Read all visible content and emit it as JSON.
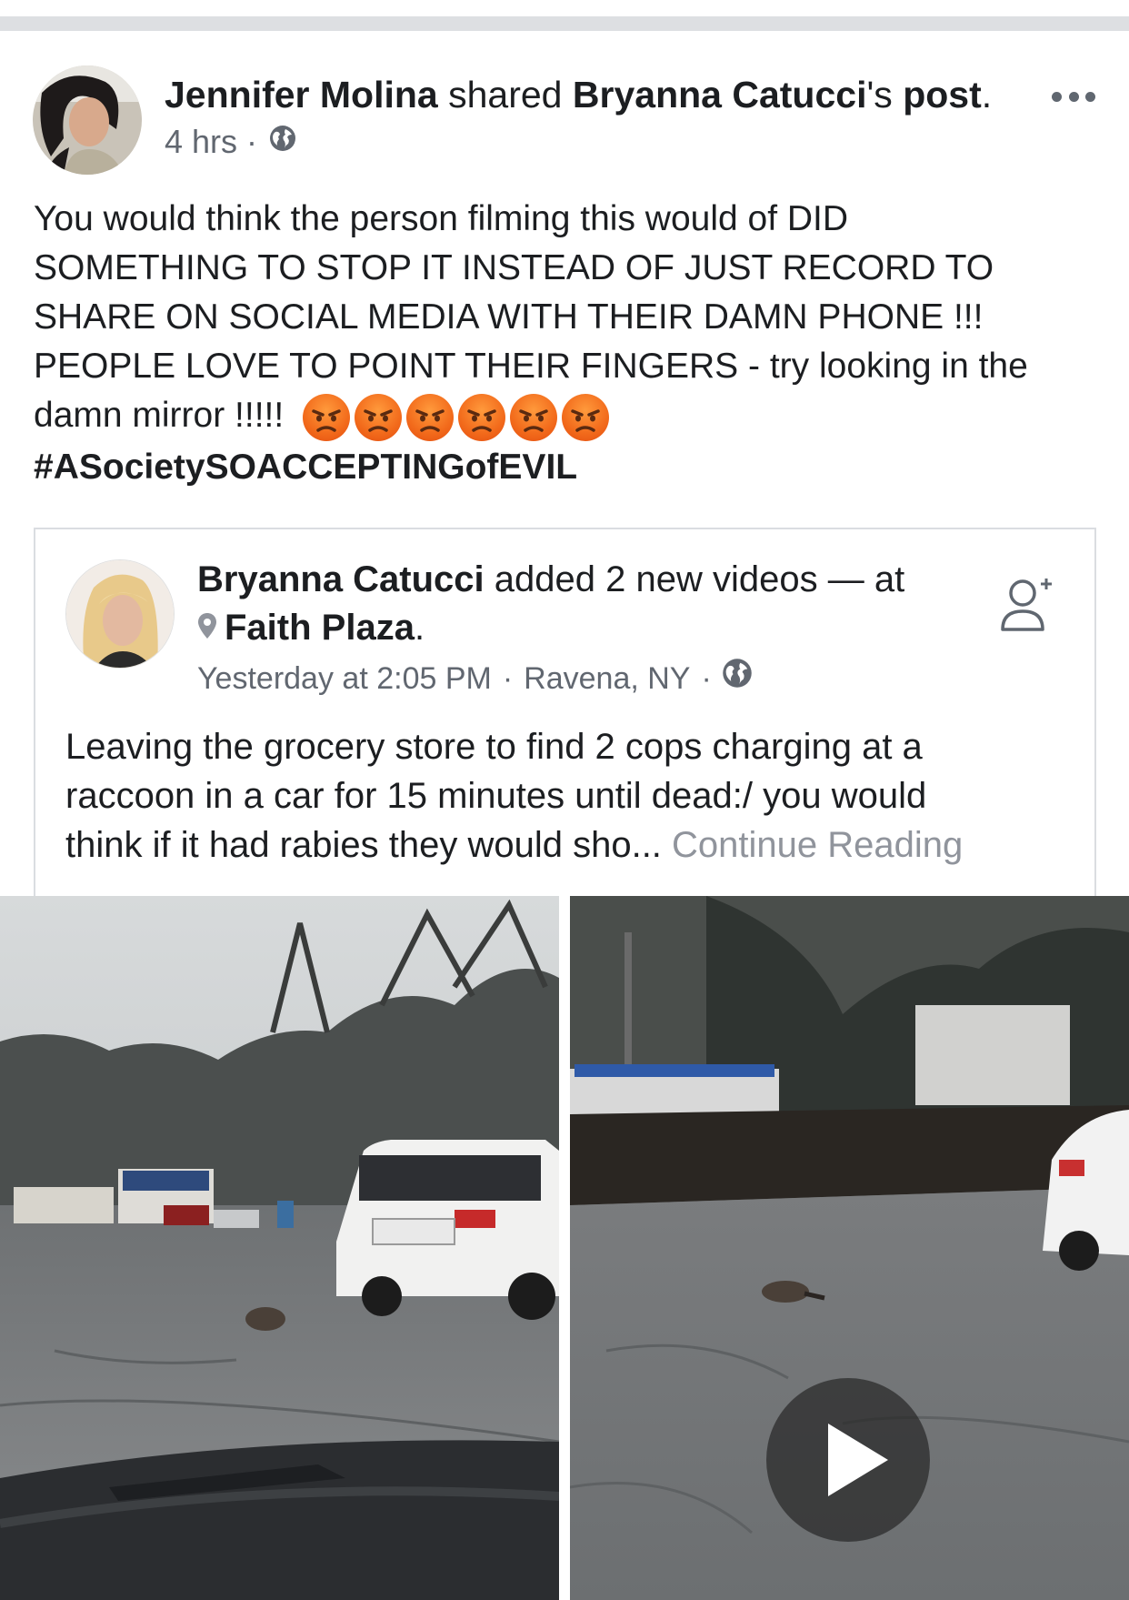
{
  "post": {
    "author": "Jennifer Molina",
    "action": "shared",
    "shared_owner": "Bryanna Catucci",
    "owner_suffix": "'s",
    "post_word": "post",
    "period": ".",
    "time": "4 hrs",
    "separator": "·",
    "audience_icon": "globe-icon",
    "text_lines": [
      "You would think the person filming this would of DID",
      "SOMETHING TO STOP IT INSTEAD OF JUST RECORD TO",
      "SHARE ON SOCIAL MEDIA WITH THEIR DAMN PHONE !!!",
      "PEOPLE LOVE TO POINT THEIR FINGERS - try looking in the",
      "damn mirror !!!!!"
    ],
    "emoji_name": "angry-face-emoji",
    "emoji_count": 6,
    "hashtag": "#ASocietySOACCEPTINGofEVIL"
  },
  "shared": {
    "author": "Bryanna Catucci",
    "action": "added 2 new videos — at",
    "place": "Faith Plaza",
    "period": ".",
    "time": "Yesterday at 2:05 PM",
    "separator": "·",
    "location": "Ravena, NY",
    "text_lines": [
      "Leaving the grocery store to find 2 cops charging at a",
      "raccoon in a car for 15 minutes until dead:/ you would",
      "think if it had rabies they would sho..."
    ],
    "continue_label": "Continue Reading"
  },
  "colors": {
    "text": "#1c1e21",
    "meta": "#616770",
    "divider": "#dddfe2",
    "emoji": "#f26a1b"
  }
}
